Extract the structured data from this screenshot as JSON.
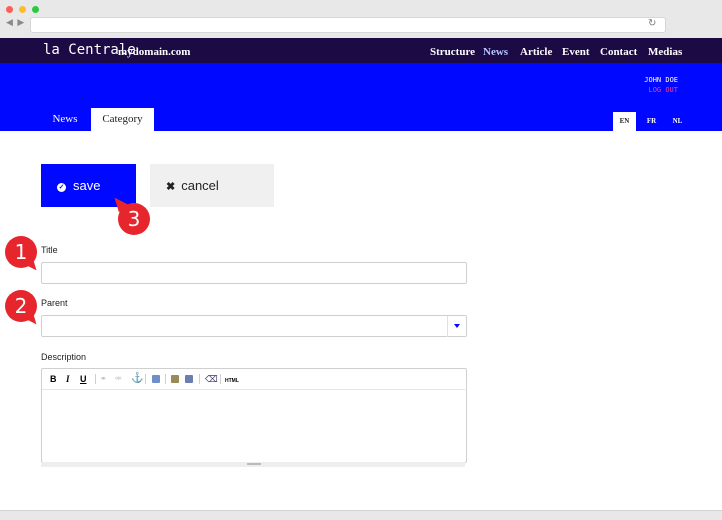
{
  "browser": {
    "nav_arrows": "◀ ▶",
    "reload_icon": "reload-icon"
  },
  "app": {
    "brand": "la Centrale",
    "domain": "mydomain.com"
  },
  "menu": [
    "Structure",
    "News",
    "Article",
    "Event",
    "Contact",
    "Medias"
  ],
  "menu_active": "News",
  "user": {
    "name": "JOHN DOE",
    "logout": "LOG OUT"
  },
  "tabs": [
    {
      "label": "News"
    },
    {
      "label": "Category"
    }
  ],
  "languages": [
    "EN",
    "FR",
    "NL"
  ],
  "actions": {
    "save_label": "save",
    "cancel_label": "cancel"
  },
  "form": {
    "title_label": "Title",
    "title_value": "",
    "parent_label": "Parent",
    "parent_value": "",
    "description_label": "Description"
  },
  "editor_toolbar": {
    "bold": "B",
    "italic": "I",
    "underline": "U",
    "html": "HTML"
  },
  "callouts": [
    "1",
    "2",
    "3"
  ],
  "colors": {
    "accent_blue": "#0008ff",
    "nav_dark": "#1c0a45",
    "logout_pink": "#ff3a9a",
    "callout_red": "#e6262c"
  }
}
